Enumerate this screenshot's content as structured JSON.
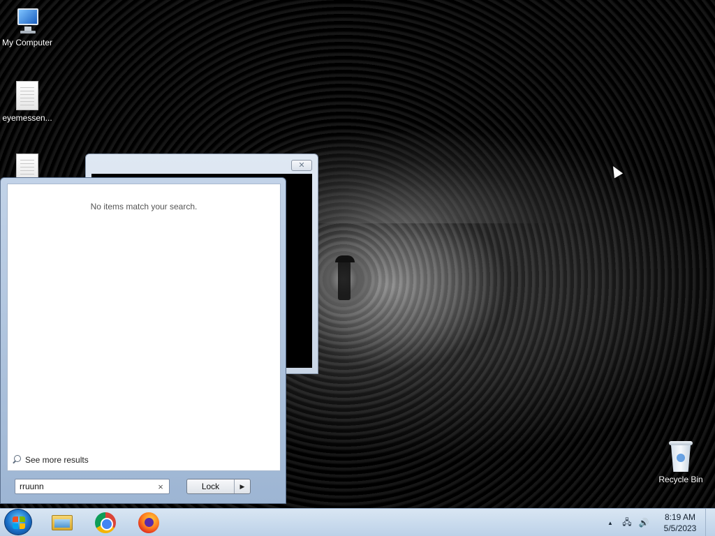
{
  "desktop": {
    "icons": [
      {
        "label": "My Computer",
        "icon": "computer-icon"
      },
      {
        "label": "eyemessen...",
        "icon": "document-icon"
      },
      {
        "label": "",
        "icon": "document-icon"
      },
      {
        "label": "Recycle Bin",
        "icon": "recycle-bin-icon"
      }
    ]
  },
  "background_window": {
    "close_symbol": "✕"
  },
  "start_menu": {
    "no_results_text": "No items match your search.",
    "see_more_label": "See more results",
    "search": {
      "value": "rruunn",
      "clear_symbol": "×"
    },
    "power_button": {
      "label": "Lock",
      "arrow": "▶"
    }
  },
  "taskbar": {
    "pinned": [
      {
        "name": "Windows Explorer",
        "icon": "folder-icon"
      },
      {
        "name": "Google Chrome",
        "icon": "chrome-icon"
      },
      {
        "name": "Firefox",
        "icon": "firefox-icon"
      }
    ],
    "tray": {
      "show_hidden": "▲",
      "network": "🖧",
      "volume": "🔊"
    },
    "clock": {
      "time": "8:19 AM",
      "date": "5/5/2023"
    }
  },
  "colors": {
    "taskbar": "#c7d8ec",
    "start_menu_frame": "#b4c8e1",
    "desktop": "#000000"
  }
}
